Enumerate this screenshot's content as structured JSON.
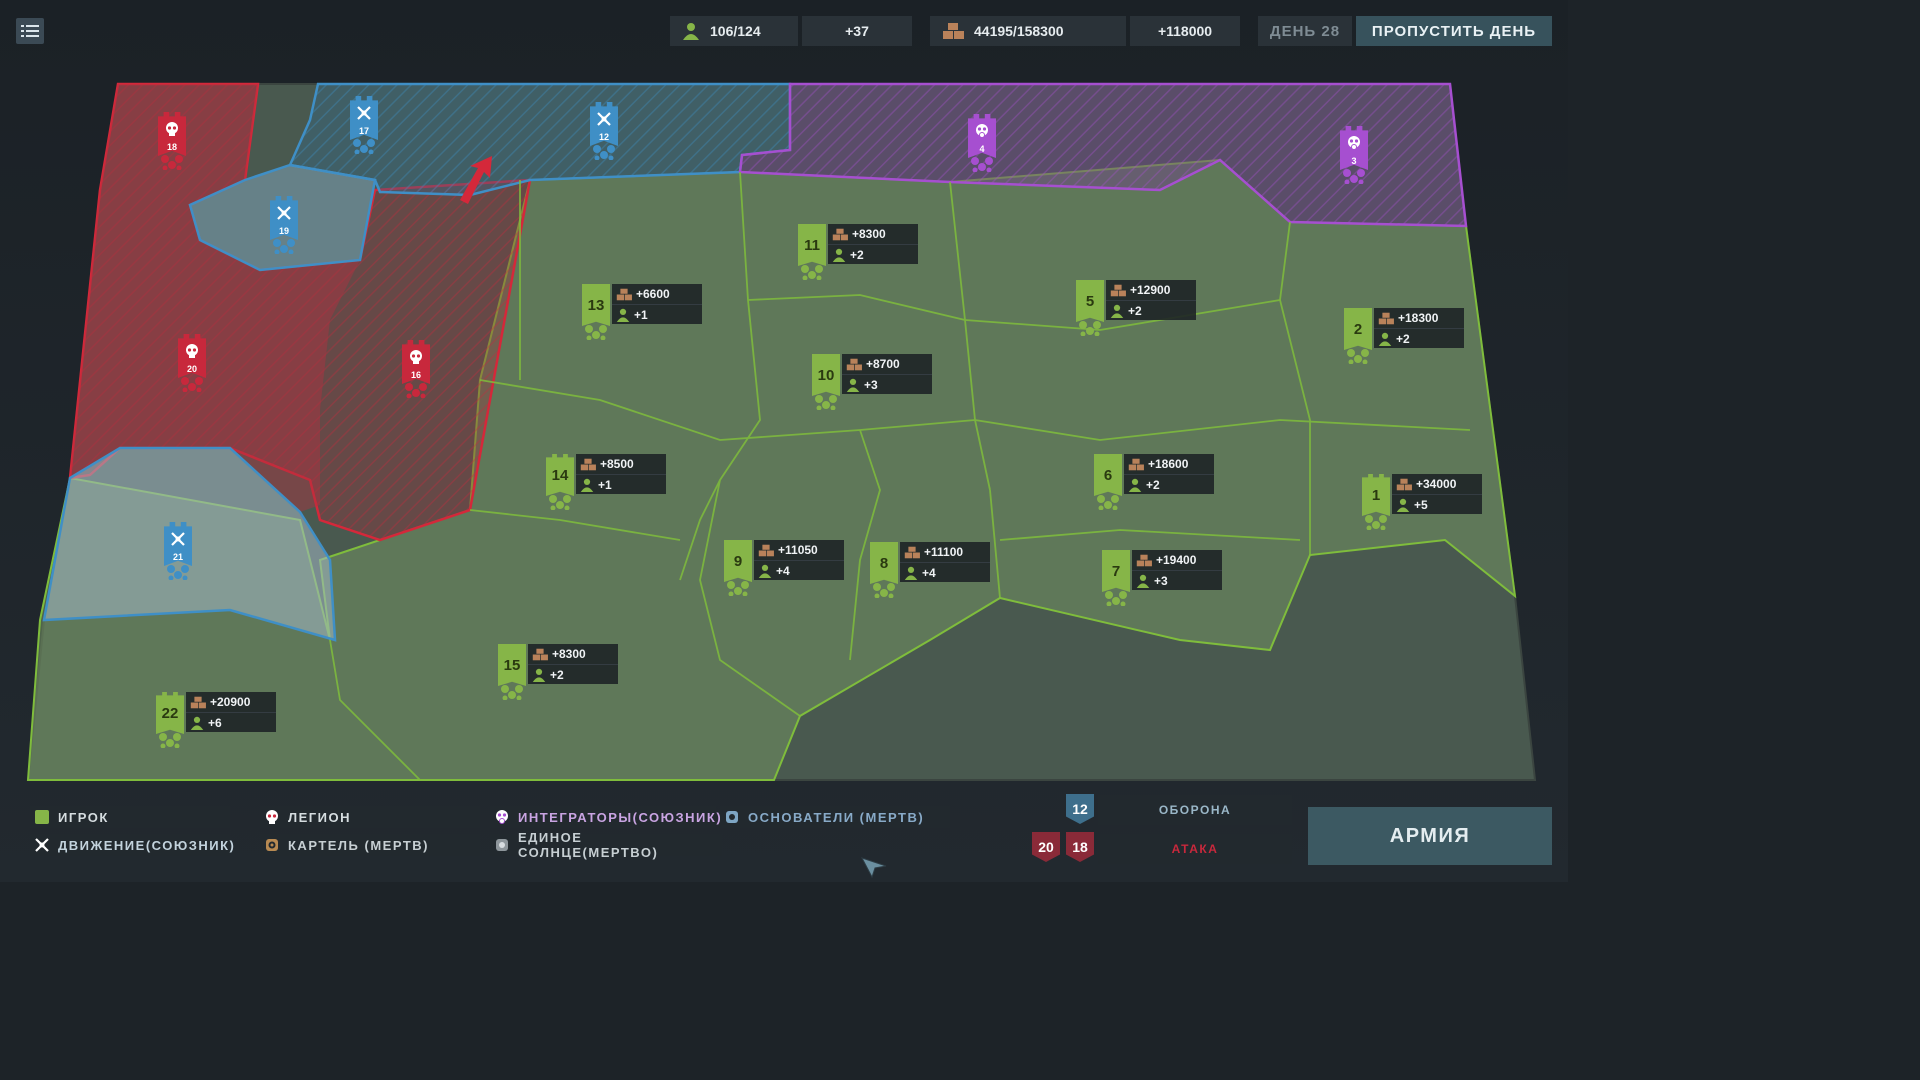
{
  "top": {
    "population": "106/124",
    "population_delta": "+37",
    "resources": "44195/158300",
    "resources_delta": "+118000",
    "day": "ДЕНЬ 28",
    "skip_day": "ПРОПУСТИТЬ ДЕНЬ"
  },
  "colors": {
    "player": "#86b548",
    "legion": "#c8283c",
    "movement": "#3f8fc6",
    "integrators": "#a64fd0",
    "panel": "#22292e",
    "army_button": "#3c5962"
  },
  "enemy_markers": [
    {
      "faction": "legion",
      "num": "18",
      "icon": "skull-icon"
    },
    {
      "faction": "legion",
      "num": "20",
      "icon": "skull-icon"
    },
    {
      "faction": "legion",
      "num": "16",
      "icon": "skull-icon"
    },
    {
      "faction": "movement",
      "num": "17",
      "icon": "cross-swords-icon"
    },
    {
      "faction": "movement",
      "num": "12",
      "icon": "cross-swords-icon"
    },
    {
      "faction": "movement",
      "num": "19",
      "icon": "cross-swords-icon"
    },
    {
      "faction": "movement",
      "num": "21",
      "icon": "cross-swords-icon"
    },
    {
      "faction": "integrators",
      "num": "4",
      "icon": "gasmask-icon"
    },
    {
      "faction": "integrators",
      "num": "3",
      "icon": "gasmask-icon"
    }
  ],
  "player_regions": [
    {
      "num": "11",
      "resources": "+8300",
      "population": "+2",
      "castle": false
    },
    {
      "num": "13",
      "resources": "+6600",
      "population": "+1",
      "castle": false
    },
    {
      "num": "5",
      "resources": "+12900",
      "population": "+2",
      "castle": false
    },
    {
      "num": "2",
      "resources": "+18300",
      "population": "+2",
      "castle": false
    },
    {
      "num": "10",
      "resources": "+8700",
      "population": "+3",
      "castle": false
    },
    {
      "num": "14",
      "resources": "+8500",
      "population": "+1",
      "castle": true
    },
    {
      "num": "6",
      "resources": "+18600",
      "population": "+2",
      "castle": false
    },
    {
      "num": "1",
      "resources": "+34000",
      "population": "+5",
      "castle": true
    },
    {
      "num": "9",
      "resources": "+11050",
      "population": "+4",
      "castle": false
    },
    {
      "num": "8",
      "resources": "+11100",
      "population": "+4",
      "castle": false
    },
    {
      "num": "7",
      "resources": "+19400",
      "population": "+3",
      "castle": false
    },
    {
      "num": "15",
      "resources": "+8300",
      "population": "+2",
      "castle": false
    },
    {
      "num": "22",
      "resources": "+20900",
      "population": "+6",
      "castle": true
    }
  ],
  "legend": [
    {
      "label": "ИГРОК",
      "color": "#86b548",
      "text_color": "#d6dde0",
      "icon": "player-swatch-icon"
    },
    {
      "label": "ЛЕГИОН",
      "color": "#c8283c",
      "text_color": "#d6dde0",
      "icon": "skull-icon"
    },
    {
      "label": "ИНТЕГРАТОРЫ(СОЮЗНИК)",
      "color": "#a64fd0",
      "text_color": "#c9a4e2",
      "icon": "gasmask-icon"
    },
    {
      "label": "ОСНОВАТЕЛИ (МЕРТВ)",
      "color": "#7ea6c4",
      "text_color": "#88aac8",
      "icon": "founders-icon"
    },
    {
      "label": "ДВИЖЕНИЕ(СОЮЗНИК)",
      "color": "#3f8fc6",
      "text_color": "#c3d3dd",
      "icon": "cross-swords-icon"
    },
    {
      "label": "КАРТЕЛЬ (МЕРТВ)",
      "color": "#b88a52",
      "text_color": "#c7cfd3",
      "icon": "cartel-icon"
    },
    {
      "label": "ЕДИНОЕ СОЛНЦЕ(МЕРТВО)",
      "color": "#8e969b",
      "text_color": "#c7cfd3",
      "icon": "sun-icon"
    }
  ],
  "battle": {
    "defense_label": "ОБОРОНА",
    "defense_region": "12",
    "attack_label": "АТАКА",
    "attack_regions": [
      "20",
      "18"
    ]
  },
  "army_button": "АРМИЯ"
}
